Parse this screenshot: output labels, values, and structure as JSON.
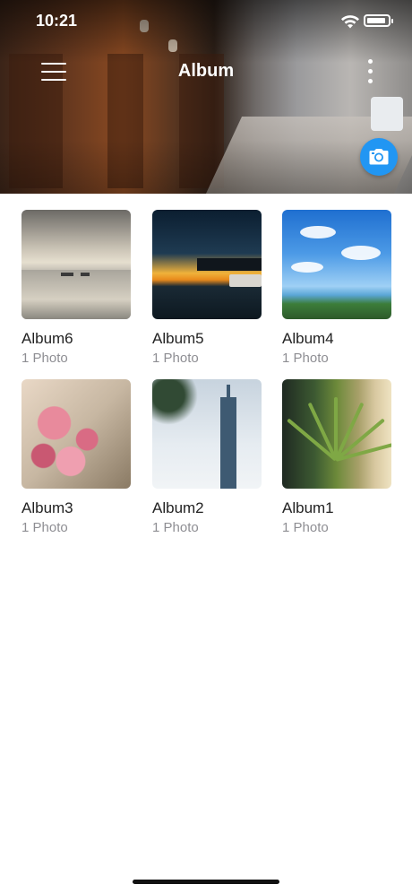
{
  "status_bar": {
    "time": "10:21"
  },
  "toolbar": {
    "title": "Album"
  },
  "albums": [
    {
      "name": "Album6",
      "count": "1 Photo"
    },
    {
      "name": "Album5",
      "count": "1 Photo"
    },
    {
      "name": "Album4",
      "count": "1 Photo"
    },
    {
      "name": "Album3",
      "count": "1 Photo"
    },
    {
      "name": "Album2",
      "count": "1 Photo"
    },
    {
      "name": "Album1",
      "count": "1 Photo"
    }
  ],
  "icons": {
    "menu": "hamburger-menu-icon",
    "more": "vertical-dots-icon",
    "camera": "camera-icon",
    "wifi": "wifi-icon",
    "battery": "battery-icon"
  },
  "colors": {
    "accent": "#2196f3",
    "count_text": "#8e8e93",
    "title_text": "#222222"
  }
}
